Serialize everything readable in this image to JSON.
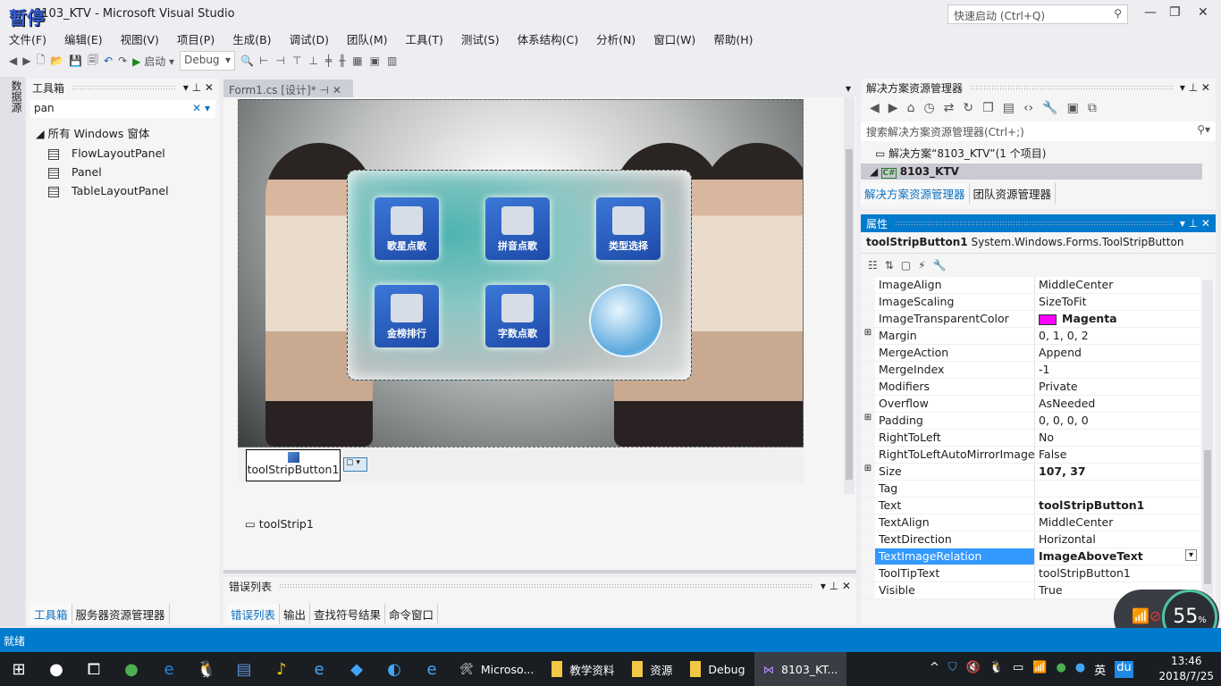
{
  "window": {
    "title": "8103_KTV - Microsoft Visual Studio",
    "overlay": "暂停",
    "quick_launch": "快速启动 (Ctrl+Q)"
  },
  "menu": [
    "文件(F)",
    "编辑(E)",
    "视图(V)",
    "项目(P)",
    "生成(B)",
    "调试(D)",
    "团队(M)",
    "工具(T)",
    "测试(S)",
    "体系结构(C)",
    "分析(N)",
    "窗口(W)",
    "帮助(H)"
  ],
  "toolbar": {
    "start": "启动",
    "config": "Debug"
  },
  "side_strip": "数据源",
  "toolbox": {
    "title": "工具箱",
    "search": "pan",
    "group": "所有 Windows 窗体",
    "items": [
      "FlowLayoutPanel",
      "Panel",
      "TableLayoutPanel"
    ]
  },
  "document": {
    "tab": "Form1.cs [设计]*",
    "buttons": [
      "歌星点歌",
      "拼音点歌",
      "类型选择",
      "金榜排行",
      "字数点歌"
    ],
    "tool_strip_button": "toolStripButton1",
    "tray_component": "toolStrip1"
  },
  "error_panel": {
    "title": "错误列表",
    "tabs": [
      "错误列表",
      "输出",
      "查找符号结果",
      "命令窗口"
    ]
  },
  "left_tabs": [
    "工具箱",
    "服务器资源管理器"
  ],
  "solution_explorer": {
    "title": "解决方案资源管理器",
    "search": "搜索解决方案资源管理器(Ctrl+;)",
    "solution": "解决方案“8103_KTV”(1 个项目)",
    "project": "8103_KTV",
    "tabs": [
      "解决方案资源管理器",
      "团队资源管理器"
    ]
  },
  "properties": {
    "title": "属性",
    "object": "toolStripButton1",
    "type": "System.Windows.Forms.ToolStripButton",
    "rows": [
      {
        "name": "ImageAlign",
        "value": "MiddleCenter"
      },
      {
        "name": "ImageScaling",
        "value": "SizeToFit"
      },
      {
        "name": "ImageTransparentColor",
        "value": "Magenta",
        "color": "#ff00ff",
        "bold": true
      },
      {
        "name": "Margin",
        "value": "0, 1, 0, 2",
        "expand": true
      },
      {
        "name": "MergeAction",
        "value": "Append"
      },
      {
        "name": "MergeIndex",
        "value": "-1"
      },
      {
        "name": "Modifiers",
        "value": "Private"
      },
      {
        "name": "Overflow",
        "value": "AsNeeded"
      },
      {
        "name": "Padding",
        "value": "0, 0, 0, 0",
        "expand": true
      },
      {
        "name": "RightToLeft",
        "value": "No"
      },
      {
        "name": "RightToLeftAutoMirrorImage",
        "value": "False"
      },
      {
        "name": "Size",
        "value": "107, 37",
        "expand": true,
        "bold": true
      },
      {
        "name": "Tag",
        "value": ""
      },
      {
        "name": "Text",
        "value": "toolStripButton1",
        "bold": true
      },
      {
        "name": "TextAlign",
        "value": "MiddleCenter"
      },
      {
        "name": "TextDirection",
        "value": "Horizontal"
      },
      {
        "name": "TextImageRelation",
        "value": "ImageAboveText",
        "bold": true,
        "selected": true
      },
      {
        "name": "ToolTipText",
        "value": "toolStripButton1"
      },
      {
        "name": "Visible",
        "value": "True"
      }
    ]
  },
  "status": "就绪",
  "network_widget": {
    "percent": "55",
    "unit": "%"
  },
  "taskbar": {
    "apps": [
      "Microso...",
      "教学资料",
      "资源",
      "Debug",
      "8103_KT..."
    ],
    "ime": "英",
    "baidu": "du",
    "time": "13:46",
    "date": "2018/7/25"
  },
  "colors": {
    "accent": "#007acc",
    "selection": "#3399ff"
  }
}
